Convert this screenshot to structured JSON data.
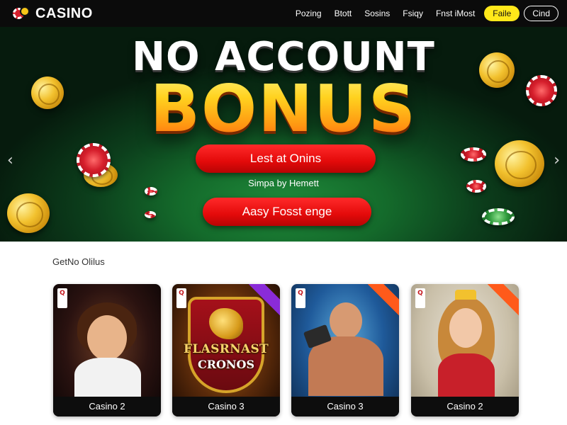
{
  "brand": {
    "name": "CASINO"
  },
  "nav": {
    "links": [
      "Pozing",
      "Btott",
      "Sosins",
      "Fsiqy",
      "Fnst iMost"
    ],
    "primary_button": "Faile",
    "outline_button": "Cind"
  },
  "hero": {
    "title_line1": "NO ACCOUNT",
    "title_line2": "BONUS",
    "button1": "Lest at Onins",
    "subtitle": "Simpa by Hemett",
    "button2": "Aasy Fosst enge",
    "arrow_left": "‹",
    "arrow_right": "›"
  },
  "games": {
    "section_title": "GetNo Olilus",
    "cards": [
      {
        "label": "Casino 2",
        "corner": "Q"
      },
      {
        "label": "Casino 3",
        "corner": "Q",
        "art_line1": "FLASRNAST",
        "art_line2": "CRONOS"
      },
      {
        "label": "Casino 3",
        "corner": "Q"
      },
      {
        "label": "Casino 2",
        "corner": "Q"
      }
    ]
  },
  "colors": {
    "topbar": "#0b0b0b",
    "accent_yellow": "#ffe81a",
    "hero_button_red": "#e30a0a",
    "hero_green": "#146a2b"
  }
}
